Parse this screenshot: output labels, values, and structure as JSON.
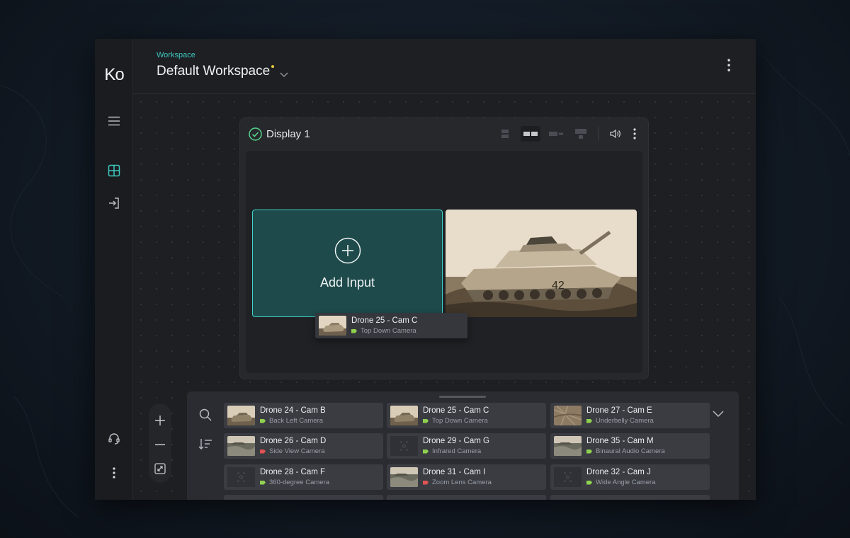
{
  "app": {
    "logo": "Ko"
  },
  "header": {
    "label": "Workspace",
    "title": "Default Workspace",
    "dropdown_icon": "chevron-down-icon",
    "menu_icon": "kebab-icon"
  },
  "sidebar": {
    "items": [
      {
        "icon": "hamburger-menu-icon"
      },
      {
        "icon": "grid-layout-icon",
        "active": true
      },
      {
        "icon": "sign-in-icon"
      },
      {
        "icon": "headset-icon"
      },
      {
        "icon": "kebab-icon"
      }
    ]
  },
  "display": {
    "title": "Display 1",
    "status_icon": "check-circle-icon",
    "layout_options": [
      "layout-stacked-icon",
      "layout-side-by-side-icon",
      "layout-wide-icon",
      "layout-top-icon"
    ],
    "active_layout": 1,
    "add_input_label": "Add Input",
    "dragging_card": {
      "name": "Drone 25 - Cam C",
      "type": "Top Down Camera",
      "tag_color": "#8fd14f"
    }
  },
  "tray": {
    "cameras": [
      {
        "name": "Drone 24 - Cam B",
        "type": "Back Left Camera",
        "tag_color": "#8fd14f",
        "thumb": "tank"
      },
      {
        "name": "Drone 25 - Cam C",
        "type": "Top Down Camera",
        "tag_color": "#8fd14f",
        "thumb": "tank"
      },
      {
        "name": "Drone 27 - Cam E",
        "type": "Underbelly Camera",
        "tag_color": "#8fd14f",
        "thumb": "terrain"
      },
      {
        "name": "Drone 26 - Cam D",
        "type": "Side View Camera",
        "tag_color": "#e05252",
        "thumb": "field"
      },
      {
        "name": "Drone 29 - Cam G",
        "type": "Infrared Camera",
        "tag_color": "#8fd14f",
        "thumb": "none"
      },
      {
        "name": "Drone 35 - Cam M",
        "type": "Binaural Audio Camera",
        "tag_color": "#8fd14f",
        "thumb": "field"
      },
      {
        "name": "Drone 28 - Cam F",
        "type": "360-degree Camera",
        "tag_color": "#8fd14f",
        "thumb": "none"
      },
      {
        "name": "Drone 31 - Cam I",
        "type": "Zoom Lens Camera",
        "tag_color": "#e05252",
        "thumb": "field"
      },
      {
        "name": "Drone 32 - Cam J",
        "type": "Wide Angle Camera",
        "tag_color": "#8fd14f",
        "thumb": "none"
      }
    ]
  },
  "colors": {
    "accent": "#3fc7c0",
    "tag_green": "#8fd14f",
    "tag_red": "#e05252",
    "unsaved_dot": "#e8c840"
  }
}
